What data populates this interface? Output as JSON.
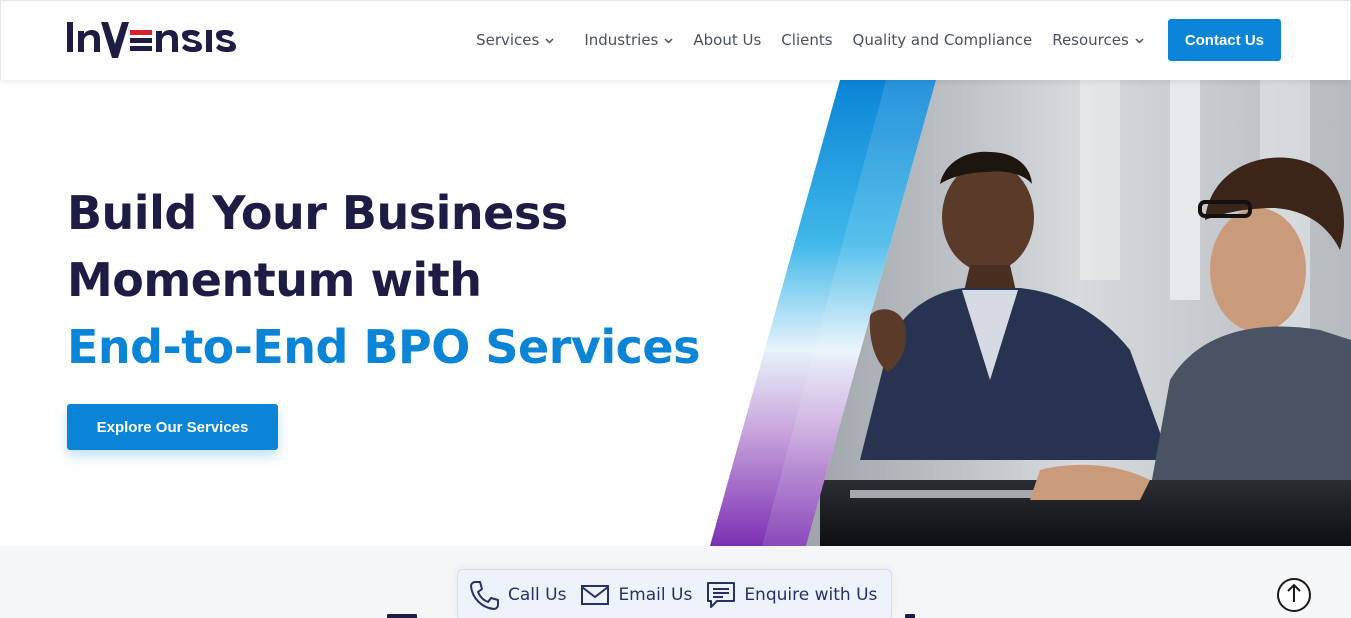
{
  "brand": {
    "name": "INVENSIS",
    "primary_color": "#0a84d6",
    "dark_color": "#1c1c44",
    "accent_red": "#d6232b"
  },
  "nav": {
    "items": [
      {
        "label": "Services",
        "has_dropdown": true
      },
      {
        "label": "Industries",
        "has_dropdown": true
      },
      {
        "label": "About Us",
        "has_dropdown": false
      },
      {
        "label": "Clients",
        "has_dropdown": false
      },
      {
        "label": "Quality and Compliance",
        "has_dropdown": false
      },
      {
        "label": "Resources",
        "has_dropdown": true
      }
    ],
    "dropdown_glyph": "⌄",
    "contact_label": "Contact Us"
  },
  "hero": {
    "title_line1": "Build Your Business",
    "title_line2": "Momentum with",
    "title_accent": "End-to-End BPO Services",
    "cta_label": "Explore Our Services",
    "image_icon": "business-meeting-photo"
  },
  "contact_bar": {
    "call_label": "Call Us",
    "email_label": "Email Us",
    "enquire_label": "Enquire with Us"
  },
  "scroll_top": {
    "icon": "arrow-up-icon"
  }
}
